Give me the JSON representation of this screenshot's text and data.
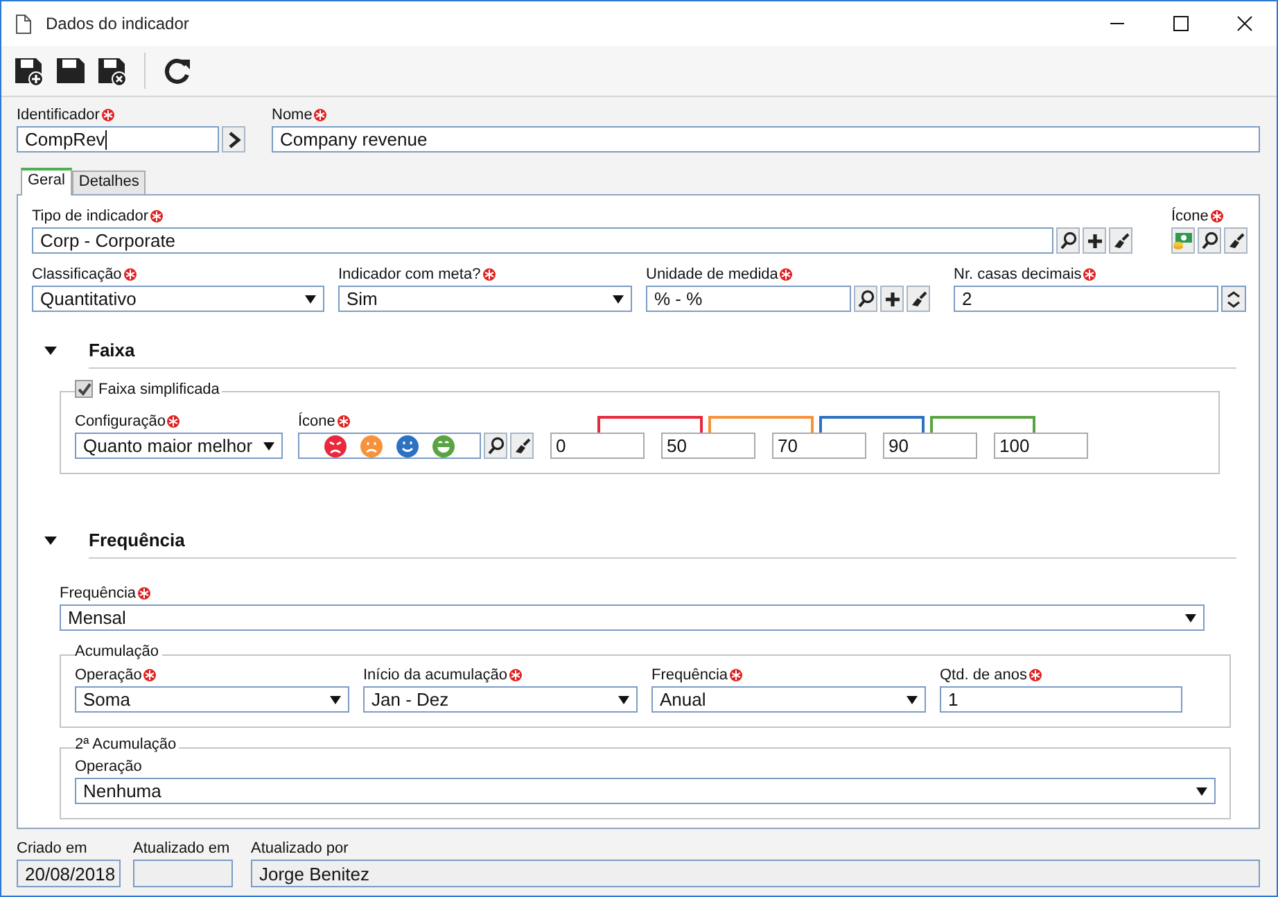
{
  "window": {
    "title": "Dados do indicador"
  },
  "identifier": {
    "label": "Identificador",
    "value": "CompRev",
    "required": true
  },
  "name": {
    "label": "Nome",
    "value": "Company revenue",
    "required": true
  },
  "tabs": [
    {
      "label": "Geral",
      "selected": true
    },
    {
      "label": "Detalhes",
      "selected": false
    }
  ],
  "general": {
    "type": {
      "label": "Tipo de indicador",
      "value": "Corp - Corporate",
      "required": true
    },
    "icon": {
      "label": "Ícone",
      "required": true
    },
    "row": [
      {
        "kind": "select",
        "label": "Classificação",
        "value": "Quantitativo",
        "required": true
      },
      {
        "kind": "select",
        "label": "Indicador com meta?",
        "value": "Sim",
        "required": true
      },
      {
        "kind": "lookup",
        "label": "Unidade de medida",
        "value": "% - %",
        "required": true
      },
      {
        "kind": "spinner",
        "label": "Nr. casas decimais",
        "value": "2",
        "required": true
      }
    ]
  },
  "range": {
    "title": "Faixa",
    "expanded": true,
    "simplified": {
      "label": "Faixa simplificada",
      "checked": true
    },
    "configuration": {
      "label": "Configuração",
      "value": "Quanto maior melhor",
      "required": true
    },
    "icon": {
      "label": "Ícone",
      "required": true
    },
    "faces": [
      {
        "kind": "angry",
        "color": "#e8283c"
      },
      {
        "kind": "sad",
        "color": "#f7923a"
      },
      {
        "kind": "smile",
        "color": "#2c72c0"
      },
      {
        "kind": "grin",
        "color": "#5aa342"
      }
    ],
    "bands": [
      {
        "color": "#e8283c"
      },
      {
        "color": "#f7923a"
      },
      {
        "color": "#2c72c0"
      },
      {
        "color": "#5aa342"
      }
    ],
    "thresholds": [
      "0",
      "50",
      "70",
      "90",
      "100"
    ]
  },
  "frequency": {
    "title": "Frequência",
    "expanded": true,
    "frequency": {
      "label": "Frequência",
      "value": "Mensal",
      "required": true
    },
    "accumulation": {
      "legend": "Acumulação",
      "fields": [
        {
          "kind": "select",
          "label": "Operação",
          "value": "Soma",
          "required": true
        },
        {
          "kind": "select",
          "label": "Início da acumulação",
          "value": "Jan - Dez",
          "required": true
        },
        {
          "kind": "select",
          "label": "Frequência",
          "value": "Anual",
          "required": true
        },
        {
          "kind": "text",
          "label": "Qtd. de anos",
          "value": "1",
          "required": true
        }
      ]
    },
    "second": {
      "legend": "2ª Acumulação",
      "operation": {
        "label": "Operação",
        "value": "Nenhuma",
        "required": false
      }
    }
  },
  "footer": [
    {
      "label": "Criado em",
      "value": "20/08/2018"
    },
    {
      "label": "Atualizado em"
    },
    {
      "label": "Atualizado por",
      "value": "Jorge Benitez"
    }
  ]
}
